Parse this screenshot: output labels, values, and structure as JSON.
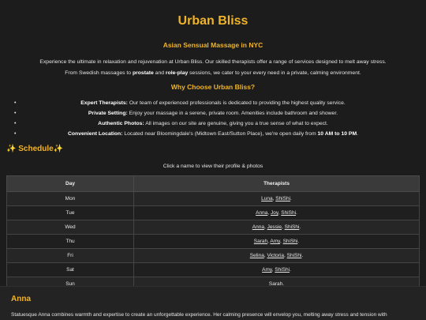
{
  "header": {
    "title": "Urban Bliss",
    "subtitle": "Asian Sensual Massage in NYC"
  },
  "intro": {
    "line1": "Experience the ultimate in relaxation and rejuvenation at Urban Bliss. Our skilled therapists offer a range of services designed to melt away stress.",
    "line2_a": "From Swedish massages to ",
    "line2_b": "prostate",
    "line2_c": " and ",
    "line2_d": "role-play",
    "line2_e": " sessions, we cater to your every need in a private, calming environment."
  },
  "why": {
    "heading": "Why Choose Urban Bliss?",
    "items": [
      {
        "label": "Expert Therapists:",
        "text": " Our team of experienced professionals is dedicated to providing the highest quality service."
      },
      {
        "label": "Private Setting:",
        "text": " Enjoy your massage in a serene, private room. Amenities include bathroom and shower."
      },
      {
        "label": "Authentic Photos:",
        "text": " All images on our site are genuine, giving you a true sense of what to expect."
      },
      {
        "label": "Convenient Location:",
        "text": " Located near Bloomingdale's (Midtown East/Sutton Place), we're open daily from ",
        "hours": "10 AM to 10 PM",
        "end": "."
      }
    ]
  },
  "schedule": {
    "spark": "✨",
    "heading": "Schedule",
    "note": "Click a name to view their profile & photos",
    "col_day": "Day",
    "col_therapists": "Therapists",
    "rows": [
      {
        "day": "Mon",
        "names": [
          "Luna",
          "ShiShi"
        ]
      },
      {
        "day": "Tue",
        "names": [
          "Anna",
          "Joy",
          "ShiShi"
        ]
      },
      {
        "day": "Wed",
        "names": [
          "Anna",
          "Jessie",
          "ShiShi"
        ]
      },
      {
        "day": "Thu",
        "names": [
          "Sarah",
          "Amy",
          "ShiShi"
        ]
      },
      {
        "day": "Fri",
        "names": [
          "Selina",
          "Victoria",
          "ShiShi"
        ]
      },
      {
        "day": "Sat",
        "names": [
          "Amy",
          "ShiShi"
        ]
      },
      {
        "day": "Sun",
        "names": [
          "Sarah"
        ]
      }
    ]
  },
  "profile": {
    "name": "Anna",
    "description": "Statuesque Anna combines warmth and expertise to create an unforgettable experience. Her calming presence will envelop you, melting away stress and tension with"
  },
  "colors": {
    "accent": "#f0b429",
    "background": "#1c1c1c"
  }
}
